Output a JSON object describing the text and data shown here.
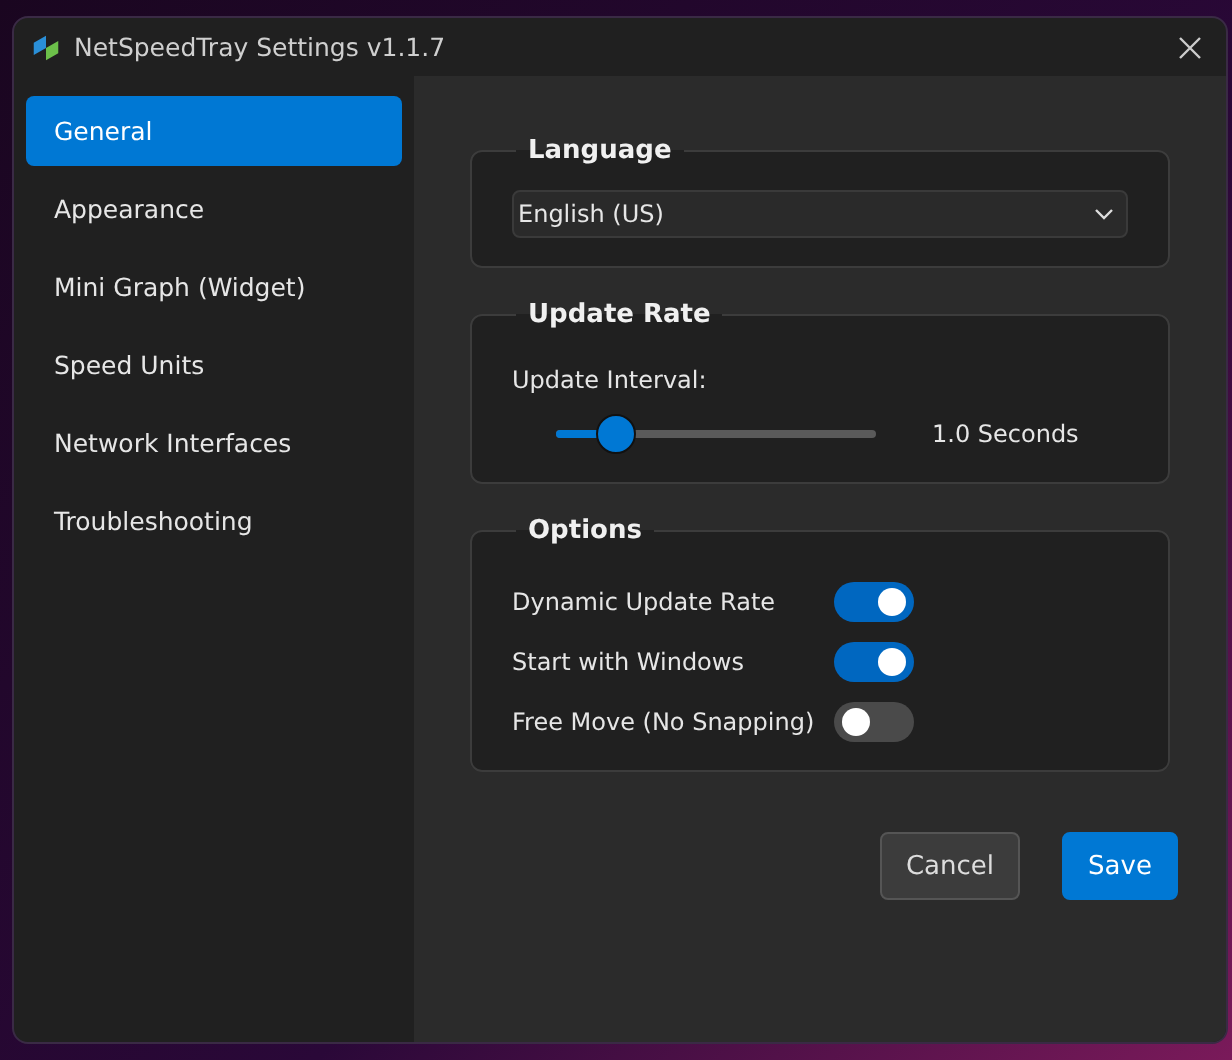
{
  "window": {
    "title": "NetSpeedTray Settings v1.1.7"
  },
  "sidebar": {
    "items": [
      {
        "label": "General",
        "selected": true
      },
      {
        "label": "Appearance",
        "selected": false
      },
      {
        "label": "Mini Graph (Widget)",
        "selected": false
      },
      {
        "label": "Speed Units",
        "selected": false
      },
      {
        "label": "Network Interfaces",
        "selected": false
      },
      {
        "label": "Troubleshooting",
        "selected": false
      }
    ]
  },
  "language": {
    "title": "Language",
    "value": "English (US)"
  },
  "update_rate": {
    "title": "Update Rate",
    "label": "Update Interval:",
    "level": 0.14,
    "reading": "1.0 Seconds"
  },
  "options": {
    "title": "Options",
    "items": [
      {
        "label": "Dynamic Update Rate",
        "on": true
      },
      {
        "label": "Start with Windows",
        "on": true
      },
      {
        "label": "Free Move (No Snapping)",
        "on": false
      }
    ]
  },
  "buttons": [
    {
      "label": "Cancel",
      "kind": "secondary"
    },
    {
      "label": "Save",
      "kind": "primary"
    }
  ]
}
